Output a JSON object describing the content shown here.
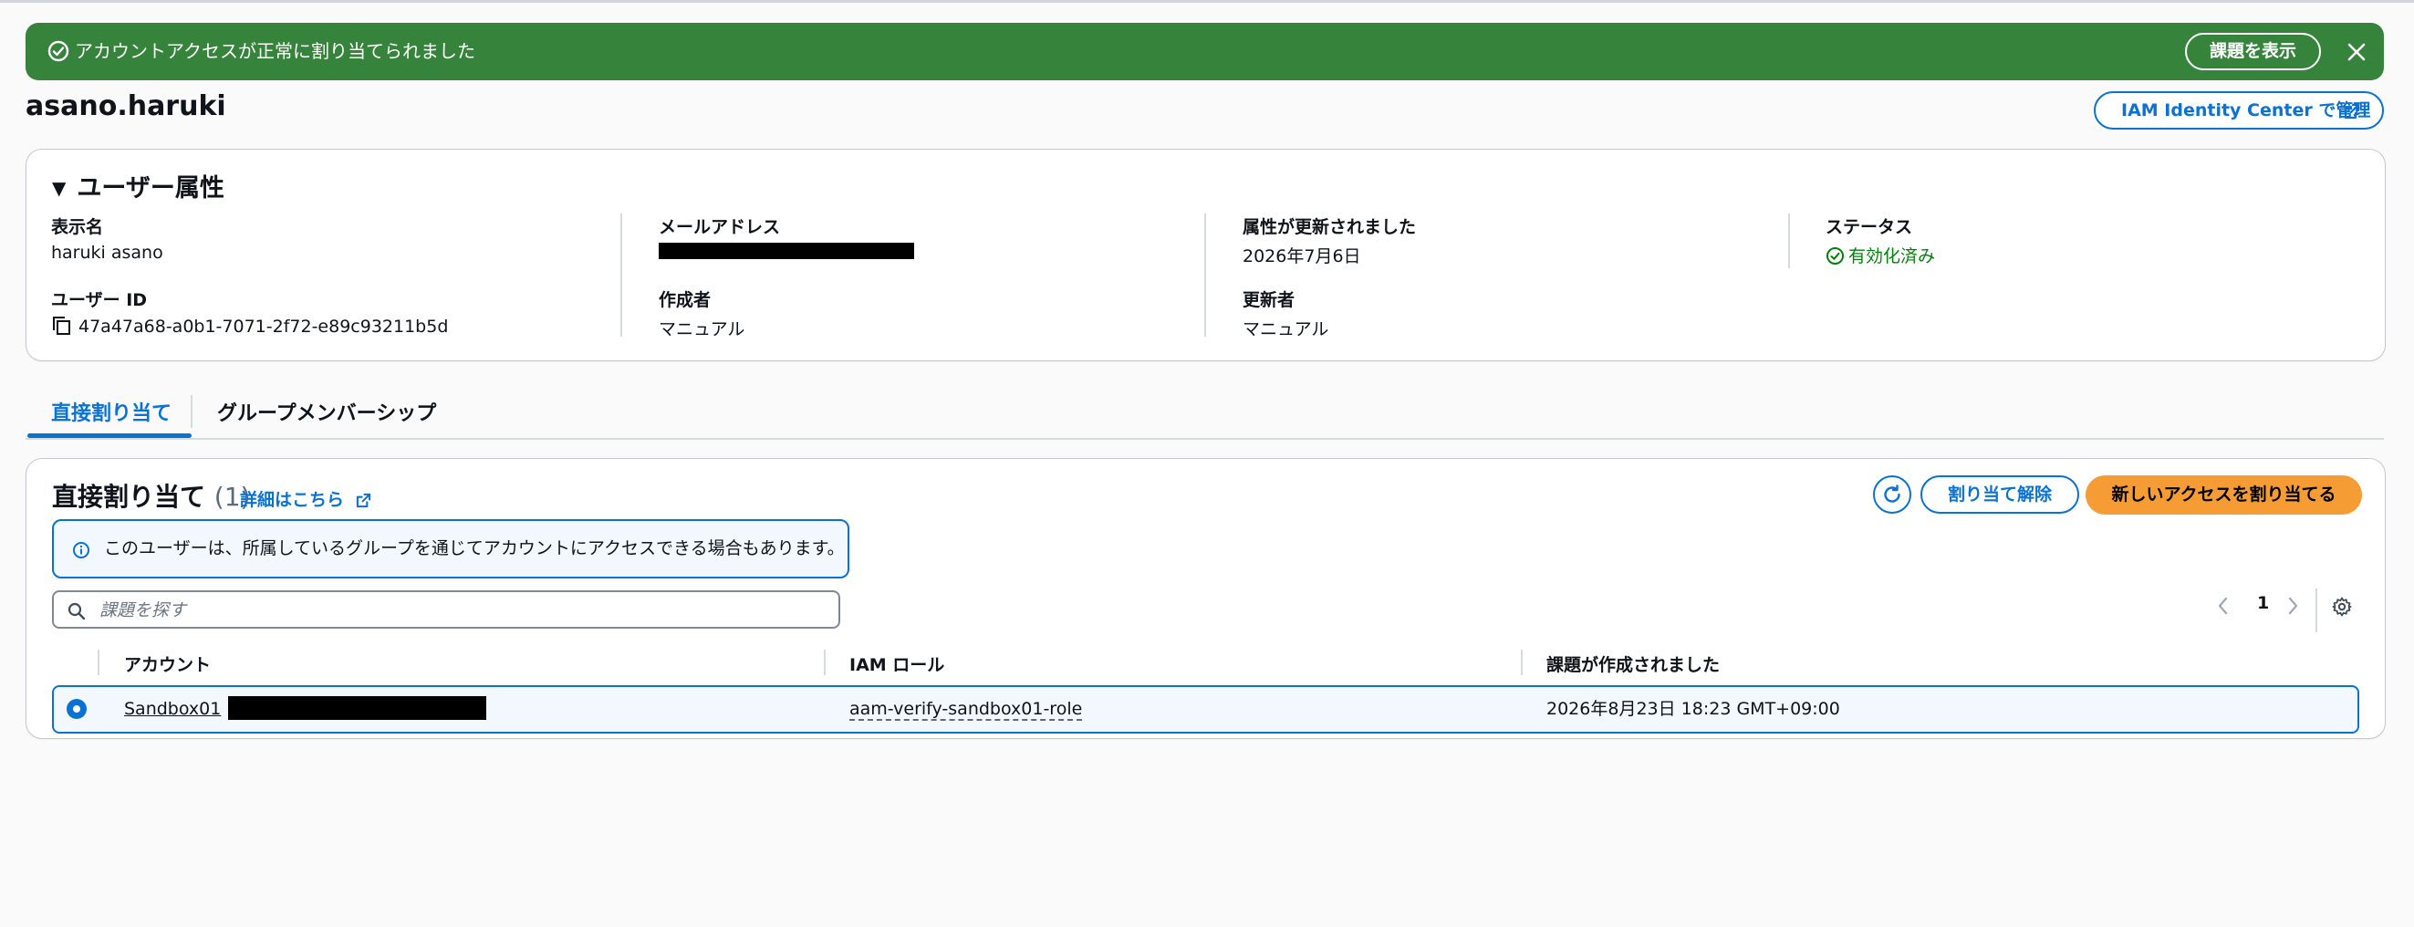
{
  "flash": {
    "message": "アカウントアクセスが正常に割り当てられました",
    "view_button": "課題を表示",
    "color": "#36833c"
  },
  "user": {
    "title": "asano.haruki",
    "manage_button": "IAM Identity Center で管理"
  },
  "attributes": {
    "heading": "ユーザー属性",
    "display_name_label": "表示名",
    "display_name": "haruki asano",
    "email_label": "メールアドレス",
    "updated_label": "属性が更新されました",
    "updated_value": "2026年7月6日",
    "status_label": "ステータス",
    "status_value": "有効化済み",
    "user_id_label": "ユーザー ID",
    "user_id": "47a47a68-a0b1-7071-2f72-e89c93211b5d",
    "created_by_label": "作成者",
    "created_by": "マニュアル",
    "updated_by_label": "更新者",
    "updated_by": "マニュアル"
  },
  "tabs": [
    "直接割り当て",
    "グループメンバーシップ"
  ],
  "assignments": {
    "title": "直接割り当て",
    "count": "(1)",
    "learn_more": "詳細はこちら",
    "unassign_button": "割り当て解除",
    "new_button": "新しいアクセスを割り当てる",
    "info_text": "このユーザーは、所属しているグループを通じてアカウントにアクセスできる場合もあります。",
    "search_placeholder": "課題を探す",
    "page": "1",
    "columns": [
      "アカウント",
      "IAM ロール",
      "課題が作成されました"
    ],
    "rows": [
      {
        "account": "Sandbox01",
        "role": "aam-verify-sandbox01-role",
        "created": "2026年8月23日 18:23 GMT+09:00",
        "selected": true
      }
    ]
  },
  "colors": {
    "accent": "#0972d3",
    "primary_button": "#f59c34",
    "success": "#037f0c"
  }
}
